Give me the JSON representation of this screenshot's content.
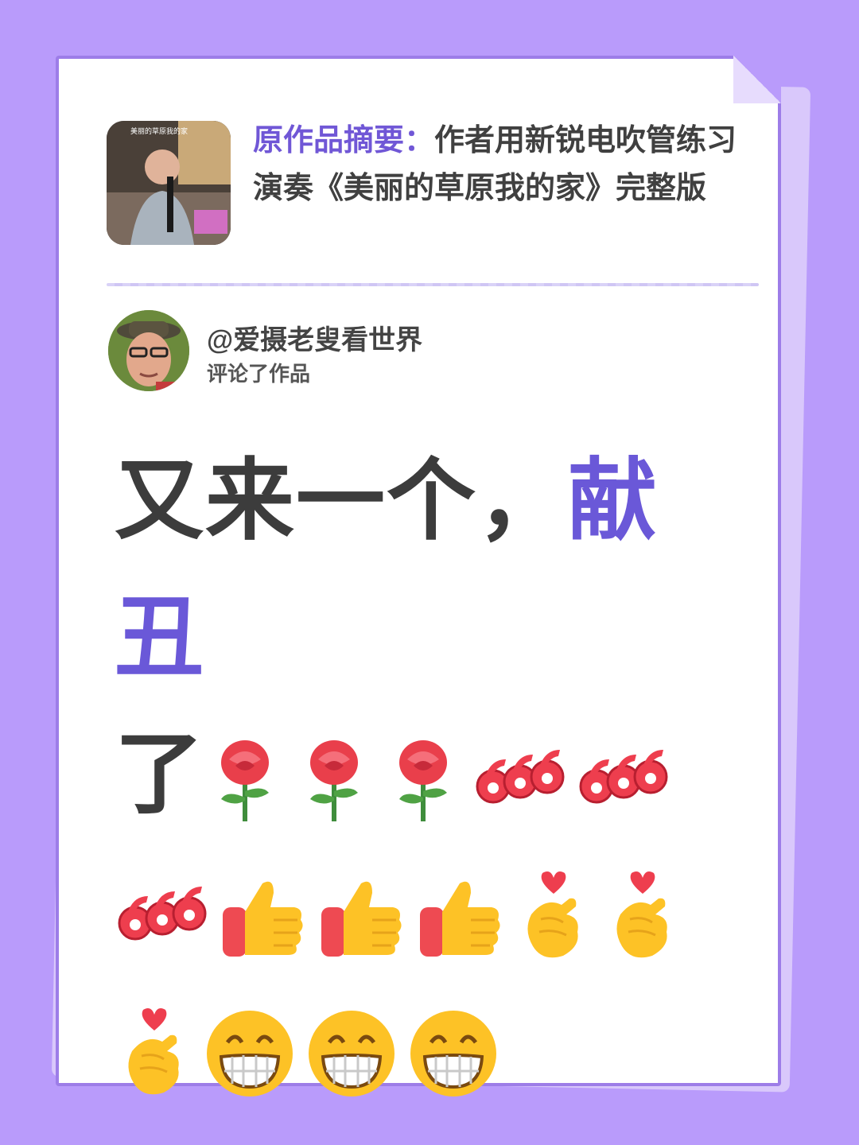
{
  "summary": {
    "label": "原作品摘要：",
    "text": "作者用新锐电吹管练习演奏《美丽的草原我的家》完整版",
    "thumbnail_caption": "美丽的草原我的家"
  },
  "commenter": {
    "name": "@爱摄老叟看世界",
    "action": "评论了作品"
  },
  "comment": {
    "text_part1": "又来一个，",
    "text_highlight": "献丑",
    "text_part2": "了"
  },
  "emojis": [
    "rose",
    "rose",
    "rose",
    "666",
    "666",
    "666",
    "thumbs-up",
    "thumbs-up",
    "thumbs-up",
    "finger-heart",
    "finger-heart",
    "finger-heart",
    "grin",
    "grin",
    "grin"
  ],
  "colors": {
    "background": "#b99bfb",
    "accent": "#6a58d8",
    "summary_label": "#7057d6",
    "text": "#3c3c3c"
  }
}
